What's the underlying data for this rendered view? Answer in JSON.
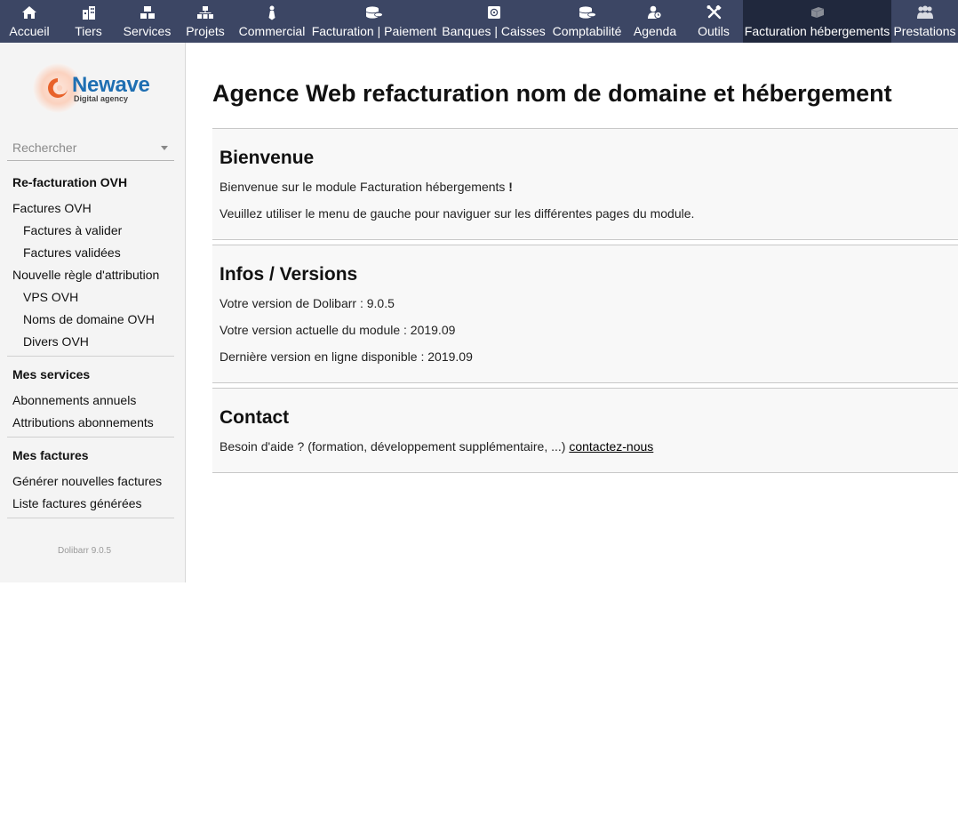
{
  "topmenu": [
    {
      "label": "Accueil",
      "icon": "home-icon"
    },
    {
      "label": "Tiers",
      "icon": "building-icon"
    },
    {
      "label": "Services",
      "icon": "boxes-icon"
    },
    {
      "label": "Projets",
      "icon": "sitemap-icon"
    },
    {
      "label": "Commercial",
      "icon": "tie-icon"
    },
    {
      "label": "Facturation | Paiement",
      "icon": "coins-icon"
    },
    {
      "label": "Banques | Caisses",
      "icon": "safe-icon"
    },
    {
      "label": "Comptabilité",
      "icon": "coins-icon"
    },
    {
      "label": "Agenda",
      "icon": "user-clock-icon"
    },
    {
      "label": "Outils",
      "icon": "tools-icon"
    },
    {
      "label": "Facturation hébergements",
      "icon": "cube-icon",
      "active": true
    },
    {
      "label": "Prestations",
      "icon": "users-icon"
    }
  ],
  "logo": {
    "brand": "Newave",
    "tagline": "Digital agency"
  },
  "search": {
    "placeholder": "Rechercher"
  },
  "leftmenu": {
    "refacturation": {
      "title": "Re-facturation OVH",
      "factures_ovh": "Factures OVH",
      "factures_a_valider": "Factures à valider",
      "factures_validees": "Factures validées",
      "nouvelle_regle": "Nouvelle règle d'attribution",
      "vps_ovh": "VPS OVH",
      "noms_domaine": "Noms de domaine OVH",
      "divers_ovh": "Divers OVH"
    },
    "services": {
      "title": "Mes services",
      "abonnements_annuels": "Abonnements annuels",
      "attributions": "Attributions abonnements"
    },
    "factures": {
      "title": "Mes factures",
      "generer": "Générer nouvelles factures",
      "liste": "Liste factures générées"
    },
    "version": "Dolibarr 9.0.5"
  },
  "main": {
    "title": "Agence Web refacturation nom de domaine et hébergement",
    "bienvenue": {
      "title": "Bienvenue",
      "line1": "Bienvenue sur le module Facturation hébergements",
      "line1_suffix": " !",
      "line2": "Veuillez utiliser le menu de gauche pour naviguer sur les différentes pages du module."
    },
    "infos": {
      "title": "Infos / Versions",
      "dolibarr": "Votre version de Dolibarr : 9.0.5",
      "module": "Votre version actuelle du module : 2019.09",
      "online": "Dernière version en ligne disponible : 2019.09"
    },
    "contact": {
      "title": "Contact",
      "text": "Besoin d'aide ? (formation, développement supplémentaire, ...) ",
      "link": "contactez-nous"
    }
  },
  "colors": {
    "topbar": "#3c4664",
    "topbar_active": "#20283d",
    "brand": "#1f6fb2",
    "brand_orange": "#e8622a"
  }
}
